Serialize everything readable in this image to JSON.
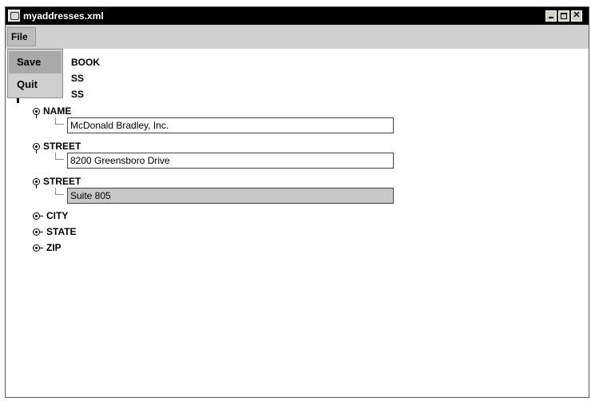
{
  "window": {
    "title": "myaddresses.xml",
    "menu": {
      "file_label": "File",
      "items": [
        {
          "label": "Save",
          "highlighted": true
        },
        {
          "label": "Quit",
          "highlighted": false
        }
      ]
    }
  },
  "tree": {
    "root_partial": "BOOK",
    "child1_partial": "SS",
    "child2_partial": "SS",
    "nodes": [
      {
        "label": "NAME",
        "expanded": true,
        "value": "McDonald Bradley, Inc."
      },
      {
        "label": "STREET",
        "expanded": true,
        "value": "8200 Greensboro Drive"
      },
      {
        "label": "STREET",
        "expanded": true,
        "value": "Suite 805",
        "selected": true
      },
      {
        "label": "CITY",
        "expanded": false
      },
      {
        "label": "STATE",
        "expanded": false
      },
      {
        "label": "ZIP",
        "expanded": false
      }
    ]
  },
  "colors": {
    "titlebar": "#000000",
    "menubar": "#d0d0d0",
    "selected_field": "#c8c8c8"
  }
}
